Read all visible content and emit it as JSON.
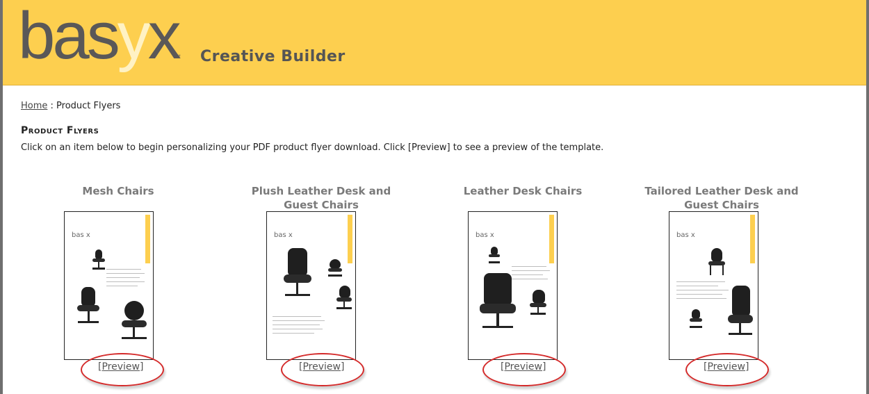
{
  "header": {
    "logo_text_a": "bas",
    "logo_text_y": "y",
    "logo_text_b": "x",
    "logo_tm": "™",
    "app_title": "Creative Builder"
  },
  "breadcrumb": {
    "home_label": "Home",
    "separator": " : ",
    "current": "Product Flyers"
  },
  "page": {
    "title": "Product Flyers",
    "intro": "Click on an item below to begin personalizing your PDF product flyer download.  Click [Preview] to see a preview of the template."
  },
  "products": [
    {
      "title": "Mesh Chairs",
      "preview_label": "[Preview]",
      "thumb_logo": "bas x"
    },
    {
      "title": "Plush Leather Desk and Guest Chairs",
      "preview_label": "[Preview]",
      "thumb_logo": "bas x"
    },
    {
      "title": "Leather Desk Chairs",
      "preview_label": "[Preview]",
      "thumb_logo": "bas x"
    },
    {
      "title": "Tailored Leather Desk and Guest Chairs",
      "preview_label": "[Preview]",
      "thumb_logo": "bas x"
    }
  ],
  "colors": {
    "header_bg": "#fdcf4f",
    "highlight_ellipse": "#d42a2a"
  }
}
